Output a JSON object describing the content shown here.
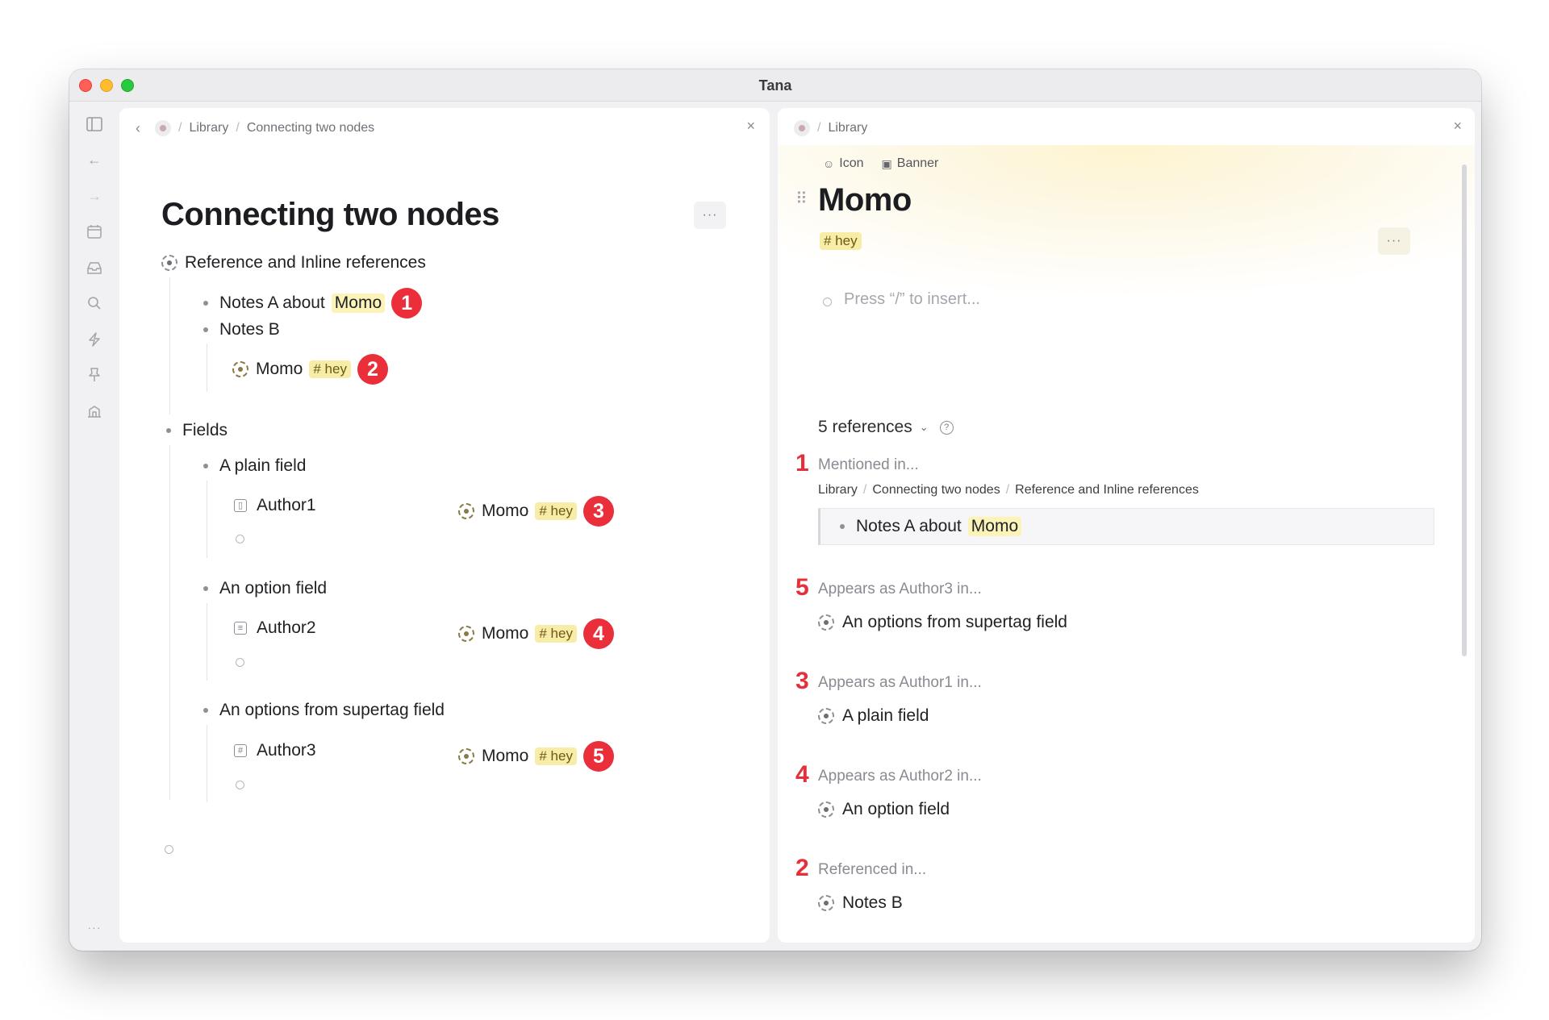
{
  "window": {
    "title": "Tana"
  },
  "sidebar": {
    "icons": [
      "sidebar-toggle-icon",
      "back-arrow-icon",
      "forward-arrow-icon",
      "calendar-icon",
      "inbox-icon",
      "search-icon",
      "lightning-icon",
      "pin-icon",
      "library-icon",
      "more-icon"
    ],
    "more_label": "···"
  },
  "left_panel": {
    "breadcrumb": [
      "Library",
      "Connecting two nodes"
    ],
    "title": "Connecting two nodes",
    "more_label": "···",
    "close_label": "×",
    "back_label": "‹",
    "reference_section": {
      "label": "Reference and Inline references",
      "notes_a": {
        "prefix": "Notes A about",
        "ref": "Momo",
        "badge": "1"
      },
      "notes_b": {
        "label": "Notes B"
      },
      "momo_ref": {
        "label": "Momo",
        "tag": "# hey",
        "badge": "2"
      }
    },
    "fields_section": {
      "label": "Fields",
      "items": [
        {
          "label": "A plain field",
          "field_name": "Author1",
          "field_icon": "field-icon",
          "value": "Momo",
          "tag": "# hey",
          "badge": "3"
        },
        {
          "label": "An option field",
          "field_name": "Author2",
          "field_icon": "options-field-icon",
          "value": "Momo",
          "tag": "# hey",
          "badge": "4"
        },
        {
          "label": "An options from supertag field",
          "field_name": "Author3",
          "field_icon": "supertag-field-icon",
          "value": "Momo",
          "tag": "# hey",
          "badge": "5"
        }
      ]
    }
  },
  "right_panel": {
    "breadcrumb": [
      "Library"
    ],
    "close_label": "×",
    "meta": {
      "icon_label": "Icon",
      "banner_label": "Banner"
    },
    "title": "Momo",
    "tag": "# hey",
    "more_label": "···",
    "placeholder": "Press “/” to insert...",
    "references": {
      "count_label": "5 references",
      "groups": [
        {
          "num": "1",
          "label": "Mentioned in...",
          "path": [
            "Library",
            "Connecting two nodes",
            "Reference and Inline references"
          ],
          "quote": {
            "prefix": "Notes A about",
            "ref": "Momo"
          }
        },
        {
          "num": "5",
          "label": "Appears as Author3 in...",
          "item": "An options from supertag field"
        },
        {
          "num": "3",
          "label": "Appears as Author1 in...",
          "item": "A plain field"
        },
        {
          "num": "4",
          "label": "Appears as Author2 in...",
          "item": "An option field"
        },
        {
          "num": "2",
          "label": "Referenced in...",
          "item": "Notes B"
        }
      ]
    }
  },
  "colors": {
    "badge": "#ea2f3a",
    "tag_bg": "#f7eca8",
    "highlight": "#fbf3b8",
    "accent_text": "#6e5a12"
  }
}
